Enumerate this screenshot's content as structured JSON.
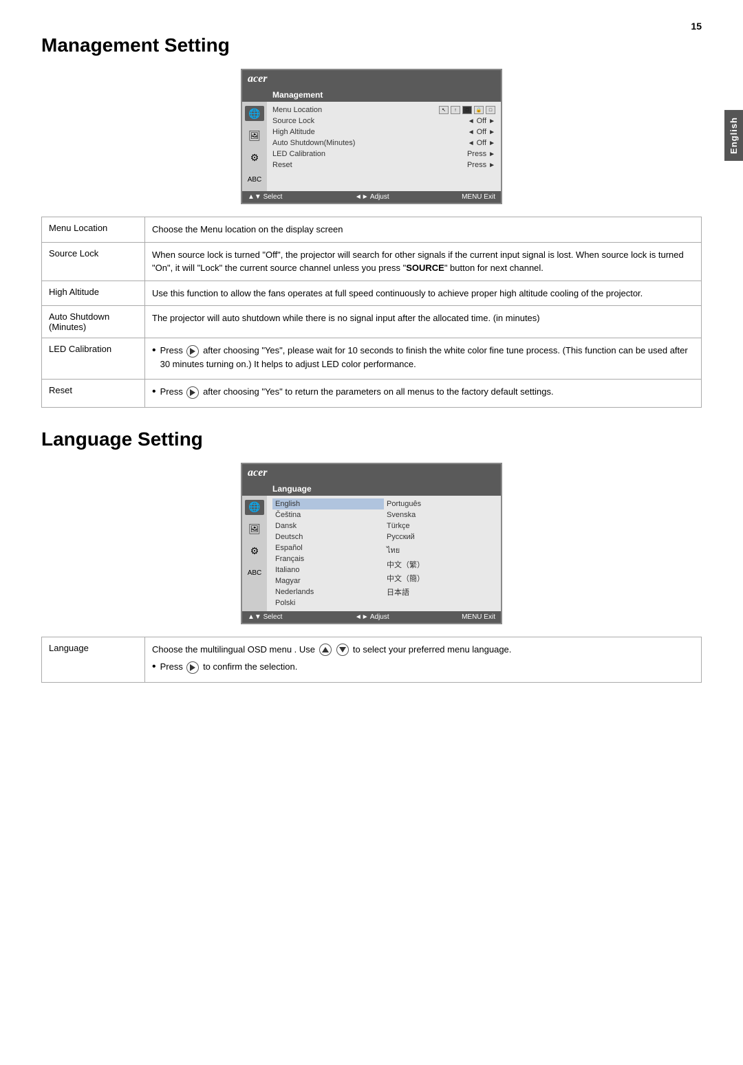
{
  "page": {
    "number": "15",
    "side_tab": "English"
  },
  "management_section": {
    "title": "Management Setting",
    "osd": {
      "brand": "acer",
      "menu_title": "Management",
      "icons": [
        "🌐",
        "🖼",
        "⚙",
        "ABC"
      ],
      "rows": [
        {
          "label": "Menu Location",
          "value": "icons",
          "highlight": false
        },
        {
          "label": "Source Lock",
          "value": "Off",
          "has_arrows": true,
          "highlight": false
        },
        {
          "label": "High Altitude",
          "value": "Off",
          "has_arrows": true,
          "highlight": false
        },
        {
          "label": "Auto Shutdown(Minutes)",
          "value": "Off",
          "has_arrows": true,
          "highlight": false
        },
        {
          "label": "LED Calibration",
          "value": "Press",
          "has_arrows": true,
          "highlight": false
        },
        {
          "label": "Reset",
          "value": "Press",
          "has_arrows": true,
          "highlight": false
        }
      ],
      "footer": {
        "select": "▲▼ Select",
        "adjust": "◄► Adjust",
        "exit": "MENU Exit"
      }
    }
  },
  "management_table": {
    "rows": [
      {
        "label": "Menu Location",
        "description": "Choose the Menu location on the display screen"
      },
      {
        "label": "Source Lock",
        "description": "When source lock is turned \"Off\", the projector will search for other signals if the current input signal is lost. When source lock is turned \"On\", it will \"Lock\" the current source channel unless you press \"SOURCE\" button for next channel."
      },
      {
        "label": "High Altitude",
        "description": "Use this function to allow the fans operates at full speed continuously to achieve proper high altitude cooling of the projector."
      },
      {
        "label": "Auto Shutdown\n(Minutes)",
        "description": "The projector will auto shutdown while there is no signal input after the allocated time. (in minutes)"
      },
      {
        "label": "LED Calibration",
        "bullets": [
          "Press ▶ after choosing \"Yes\", please wait for 10 seconds to finish the white color fine tune process. (This function can be used after 30 minutes turning on.) It helps to adjust LED color performance."
        ]
      },
      {
        "label": "Reset",
        "bullets": [
          "Press ▶ after choosing \"Yes\" to return the parameters on all menus to the factory default settings."
        ]
      }
    ]
  },
  "language_section": {
    "title": "Language Setting",
    "osd": {
      "brand": "acer",
      "menu_title": "Language",
      "left_langs": [
        "English",
        "Čeština",
        "Dansk",
        "Deutsch",
        "Español",
        "Français",
        "Italiano",
        "Magyar",
        "Nederlands",
        "Polski"
      ],
      "right_langs": [
        "Português",
        "Svenska",
        "Türkçe",
        "Русский",
        "ไทย",
        "中文（繁）",
        "中文（簡）",
        "日本語"
      ],
      "footer": {
        "select": "▲▼ Select",
        "adjust": "◄► Adjust",
        "exit": "MENU Exit"
      }
    }
  },
  "language_table": {
    "rows": [
      {
        "label": "Language",
        "description": "Choose the multilingual OSD menu . Use",
        "description2": "to select your preferred menu language.",
        "bullet": "Press ▶ to confirm the selection."
      }
    ]
  }
}
